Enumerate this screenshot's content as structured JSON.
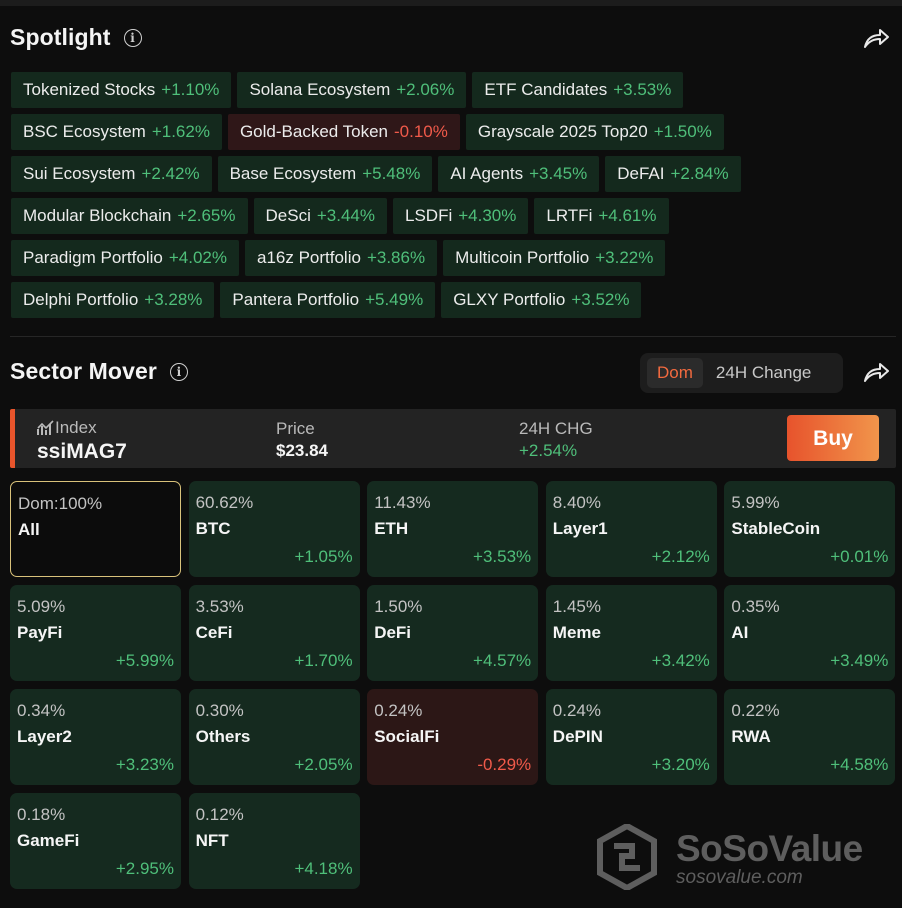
{
  "spotlight": {
    "title": "Spotlight",
    "chips": [
      [
        {
          "name": "Tokenized Stocks",
          "change": "+1.10%"
        },
        {
          "name": "Solana Ecosystem",
          "change": "+2.06%"
        },
        {
          "name": "ETF Candidates",
          "change": "+3.53%"
        }
      ],
      [
        {
          "name": "BSC Ecosystem",
          "change": "+1.62%"
        },
        {
          "name": "Gold-Backed Token",
          "change": "-0.10%",
          "negative": true
        },
        {
          "name": "Grayscale 2025 Top20",
          "change": "+1.50%"
        }
      ],
      [
        {
          "name": "Sui Ecosystem",
          "change": "+2.42%"
        },
        {
          "name": "Base Ecosystem",
          "change": "+5.48%"
        },
        {
          "name": "AI Agents",
          "change": "+3.45%"
        },
        {
          "name": "DeFAI",
          "change": "+2.84%"
        }
      ],
      [
        {
          "name": "Modular Blockchain",
          "change": "+2.65%"
        },
        {
          "name": "DeSci",
          "change": "+3.44%"
        },
        {
          "name": "LSDFi",
          "change": "+4.30%"
        },
        {
          "name": "LRTFi",
          "change": "+4.61%"
        }
      ],
      [
        {
          "name": "Paradigm Portfolio",
          "change": "+4.02%"
        },
        {
          "name": "a16z Portfolio",
          "change": "+3.86%"
        },
        {
          "name": "Multicoin Portfolio",
          "change": "+3.22%"
        }
      ],
      [
        {
          "name": "Delphi Portfolio",
          "change": "+3.28%"
        },
        {
          "name": "Pantera Portfolio",
          "change": "+5.49%"
        },
        {
          "name": "GLXY Portfolio",
          "change": "+3.52%"
        }
      ]
    ]
  },
  "sector_mover": {
    "title": "Sector Mover",
    "toggle": {
      "active": "Dom",
      "inactive": "24H Change"
    },
    "index": {
      "label": "Index",
      "name": "ssiMAG7",
      "price_label": "Price",
      "price": "$23.84",
      "change_label": "24H CHG",
      "change": "+2.54%",
      "buy_label": "Buy"
    },
    "tiles": [
      {
        "dom": "Dom:100%",
        "name": "All",
        "change": "",
        "kind": "all"
      },
      {
        "dom": "60.62%",
        "name": "BTC",
        "change": "+1.05%"
      },
      {
        "dom": "11.43%",
        "name": "ETH",
        "change": "+3.53%"
      },
      {
        "dom": "8.40%",
        "name": "Layer1",
        "change": "+2.12%"
      },
      {
        "dom": "5.99%",
        "name": "StableCoin",
        "change": "+0.01%"
      },
      {
        "dom": "5.09%",
        "name": "PayFi",
        "change": "+5.99%"
      },
      {
        "dom": "3.53%",
        "name": "CeFi",
        "change": "+1.70%"
      },
      {
        "dom": "1.50%",
        "name": "DeFi",
        "change": "+4.57%"
      },
      {
        "dom": "1.45%",
        "name": "Meme",
        "change": "+3.42%"
      },
      {
        "dom": "0.35%",
        "name": "AI",
        "change": "+3.49%"
      },
      {
        "dom": "0.34%",
        "name": "Layer2",
        "change": "+3.23%"
      },
      {
        "dom": "0.30%",
        "name": "Others",
        "change": "+2.05%"
      },
      {
        "dom": "0.24%",
        "name": "SocialFi",
        "change": "-0.29%",
        "kind": "neg"
      },
      {
        "dom": "0.24%",
        "name": "DePIN",
        "change": "+3.20%"
      },
      {
        "dom": "0.22%",
        "name": "RWA",
        "change": "+4.58%"
      },
      {
        "dom": "0.18%",
        "name": "GameFi",
        "change": "+2.95%"
      },
      {
        "dom": "0.12%",
        "name": "NFT",
        "change": "+4.18%"
      }
    ]
  },
  "watermark": {
    "brand": "SoSoValue",
    "url": "sosovalue.com"
  },
  "colors": {
    "positive": "#4fbf7a",
    "negative": "#f05a4a",
    "accent": "#e8552c",
    "selected_border": "#d9c27b"
  },
  "icons": {
    "info": "info-circle-icon",
    "share": "share-arrow-icon",
    "index": "chart-line-icon",
    "logo": "sosovalue-logo-icon"
  }
}
